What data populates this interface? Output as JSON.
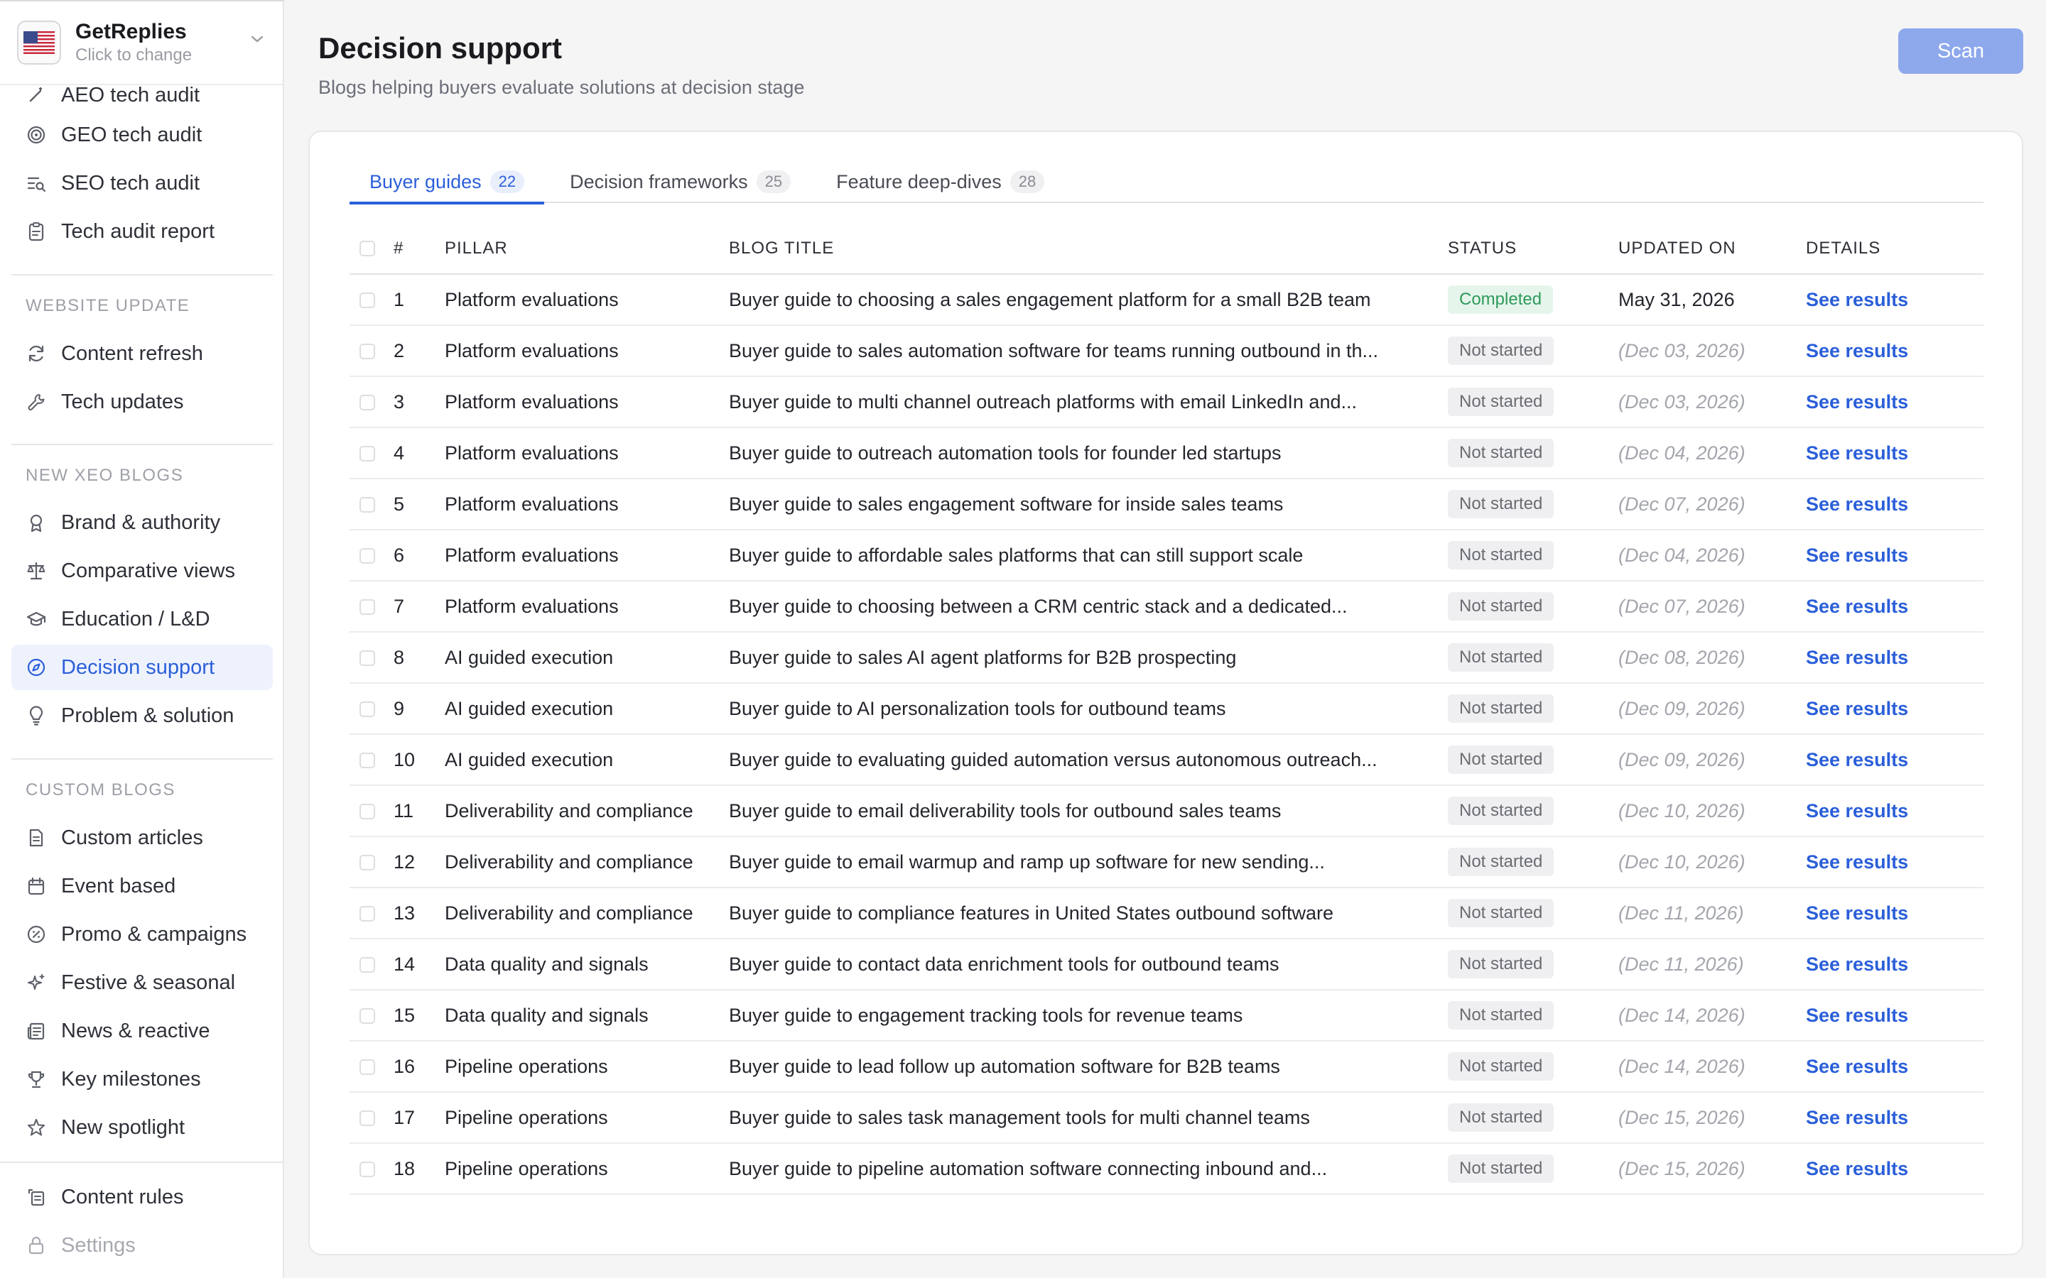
{
  "workspace": {
    "name": "GetReplies",
    "sub": "Click to change"
  },
  "sidebar": {
    "top_items": [
      {
        "label": "AEO tech audit",
        "icon": "wand-icon"
      },
      {
        "label": "GEO tech audit",
        "icon": "target-icon"
      },
      {
        "label": "SEO tech audit",
        "icon": "list-search-icon"
      },
      {
        "label": "Tech audit report",
        "icon": "clipboard-icon"
      }
    ],
    "sections": [
      {
        "title": "WEBSITE UPDATE",
        "items": [
          {
            "label": "Content refresh",
            "icon": "refresh-icon"
          },
          {
            "label": "Tech updates",
            "icon": "wrench-icon"
          }
        ]
      },
      {
        "title": "NEW XEO BLOGS",
        "items": [
          {
            "label": "Brand & authority",
            "icon": "award-icon"
          },
          {
            "label": "Comparative views",
            "icon": "scale-icon"
          },
          {
            "label": "Education / L&D",
            "icon": "graduation-cap-icon"
          },
          {
            "label": "Decision support",
            "icon": "compass-icon"
          },
          {
            "label": "Problem & solution",
            "icon": "lightbulb-icon"
          }
        ]
      },
      {
        "title": "CUSTOM BLOGS",
        "items": [
          {
            "label": "Custom articles",
            "icon": "document-icon"
          },
          {
            "label": "Event based",
            "icon": "calendar-icon"
          },
          {
            "label": "Promo & campaigns",
            "icon": "percent-badge-icon"
          },
          {
            "label": "Festive & seasonal",
            "icon": "sparkles-icon"
          },
          {
            "label": "News & reactive",
            "icon": "newspaper-icon"
          },
          {
            "label": "Key milestones",
            "icon": "trophy-icon"
          },
          {
            "label": "New spotlight",
            "icon": "star-icon"
          }
        ]
      }
    ],
    "bottom_items": [
      {
        "label": "Content rules",
        "icon": "rules-icon"
      },
      {
        "label": "Settings",
        "icon": "lock-icon"
      }
    ]
  },
  "page": {
    "title": "Decision support",
    "subtitle": "Blogs helping buyers evaluate solutions at decision stage",
    "scan_label": "Scan"
  },
  "tabs": [
    {
      "label": "Buyer guides",
      "count": "22"
    },
    {
      "label": "Decision frameworks",
      "count": "25"
    },
    {
      "label": "Feature deep-dives",
      "count": "28"
    }
  ],
  "table": {
    "headers": {
      "num": "#",
      "pillar": "PILLAR",
      "title": "BLOG TITLE",
      "status": "STATUS",
      "updated": "UPDATED ON",
      "details": "DETAILS"
    },
    "rows": [
      {
        "num": "1",
        "pillar": "Platform evaluations",
        "title": "Buyer guide to choosing a sales engagement platform for a small B2B team",
        "status": "Completed",
        "updated": "May 31, 2026",
        "details": "See results"
      },
      {
        "num": "2",
        "pillar": "Platform evaluations",
        "title": "Buyer guide to sales automation software for teams running outbound in th...",
        "status": "Not started",
        "updated": "(Dec 03, 2026)",
        "details": "See results"
      },
      {
        "num": "3",
        "pillar": "Platform evaluations",
        "title": "Buyer guide to multi channel outreach platforms with email LinkedIn and...",
        "status": "Not started",
        "updated": "(Dec 03, 2026)",
        "details": "See results"
      },
      {
        "num": "4",
        "pillar": "Platform evaluations",
        "title": "Buyer guide to outreach automation tools for founder led startups",
        "status": "Not started",
        "updated": "(Dec 04, 2026)",
        "details": "See results"
      },
      {
        "num": "5",
        "pillar": "Platform evaluations",
        "title": "Buyer guide to sales engagement software for inside sales teams",
        "status": "Not started",
        "updated": "(Dec 07, 2026)",
        "details": "See results"
      },
      {
        "num": "6",
        "pillar": "Platform evaluations",
        "title": "Buyer guide to affordable sales platforms that can still support scale",
        "status": "Not started",
        "updated": "(Dec 04, 2026)",
        "details": "See results"
      },
      {
        "num": "7",
        "pillar": "Platform evaluations",
        "title": "Buyer guide to choosing between a CRM centric stack and a dedicated...",
        "status": "Not started",
        "updated": "(Dec 07, 2026)",
        "details": "See results"
      },
      {
        "num": "8",
        "pillar": "AI guided execution",
        "title": "Buyer guide to sales AI agent platforms for B2B prospecting",
        "status": "Not started",
        "updated": "(Dec 08, 2026)",
        "details": "See results"
      },
      {
        "num": "9",
        "pillar": "AI guided execution",
        "title": "Buyer guide to AI personalization tools for outbound teams",
        "status": "Not started",
        "updated": "(Dec 09, 2026)",
        "details": "See results"
      },
      {
        "num": "10",
        "pillar": "AI guided execution",
        "title": "Buyer guide to evaluating guided automation versus autonomous outreach...",
        "status": "Not started",
        "updated": "(Dec 09, 2026)",
        "details": "See results"
      },
      {
        "num": "11",
        "pillar": "Deliverability and compliance",
        "title": "Buyer guide to email deliverability tools for outbound sales teams",
        "status": "Not started",
        "updated": "(Dec 10, 2026)",
        "details": "See results"
      },
      {
        "num": "12",
        "pillar": "Deliverability and compliance",
        "title": "Buyer guide to email warmup and ramp up software for new sending...",
        "status": "Not started",
        "updated": "(Dec 10, 2026)",
        "details": "See results"
      },
      {
        "num": "13",
        "pillar": "Deliverability and compliance",
        "title": "Buyer guide to compliance features in United States outbound software",
        "status": "Not started",
        "updated": "(Dec 11, 2026)",
        "details": "See results"
      },
      {
        "num": "14",
        "pillar": "Data quality and signals",
        "title": "Buyer guide to contact data enrichment tools for outbound teams",
        "status": "Not started",
        "updated": "(Dec 11, 2026)",
        "details": "See results"
      },
      {
        "num": "15",
        "pillar": "Data quality and signals",
        "title": "Buyer guide to engagement tracking tools for revenue teams",
        "status": "Not started",
        "updated": "(Dec 14, 2026)",
        "details": "See results"
      },
      {
        "num": "16",
        "pillar": "Pipeline operations",
        "title": "Buyer guide to lead follow up automation software for B2B teams",
        "status": "Not started",
        "updated": "(Dec 14, 2026)",
        "details": "See results"
      },
      {
        "num": "17",
        "pillar": "Pipeline operations",
        "title": "Buyer guide to sales task management tools for multi channel teams",
        "status": "Not started",
        "updated": "(Dec 15, 2026)",
        "details": "See results"
      },
      {
        "num": "18",
        "pillar": "Pipeline operations",
        "title": "Buyer guide to pipeline automation software connecting inbound and...",
        "status": "Not started",
        "updated": "(Dec 15, 2026)",
        "details": "See results"
      }
    ]
  },
  "colors": {
    "accent": "#2b5fd9",
    "active_bg": "#eef2fd",
    "scan_button": "#8ea8ec",
    "completed": "#2e9a5a"
  }
}
